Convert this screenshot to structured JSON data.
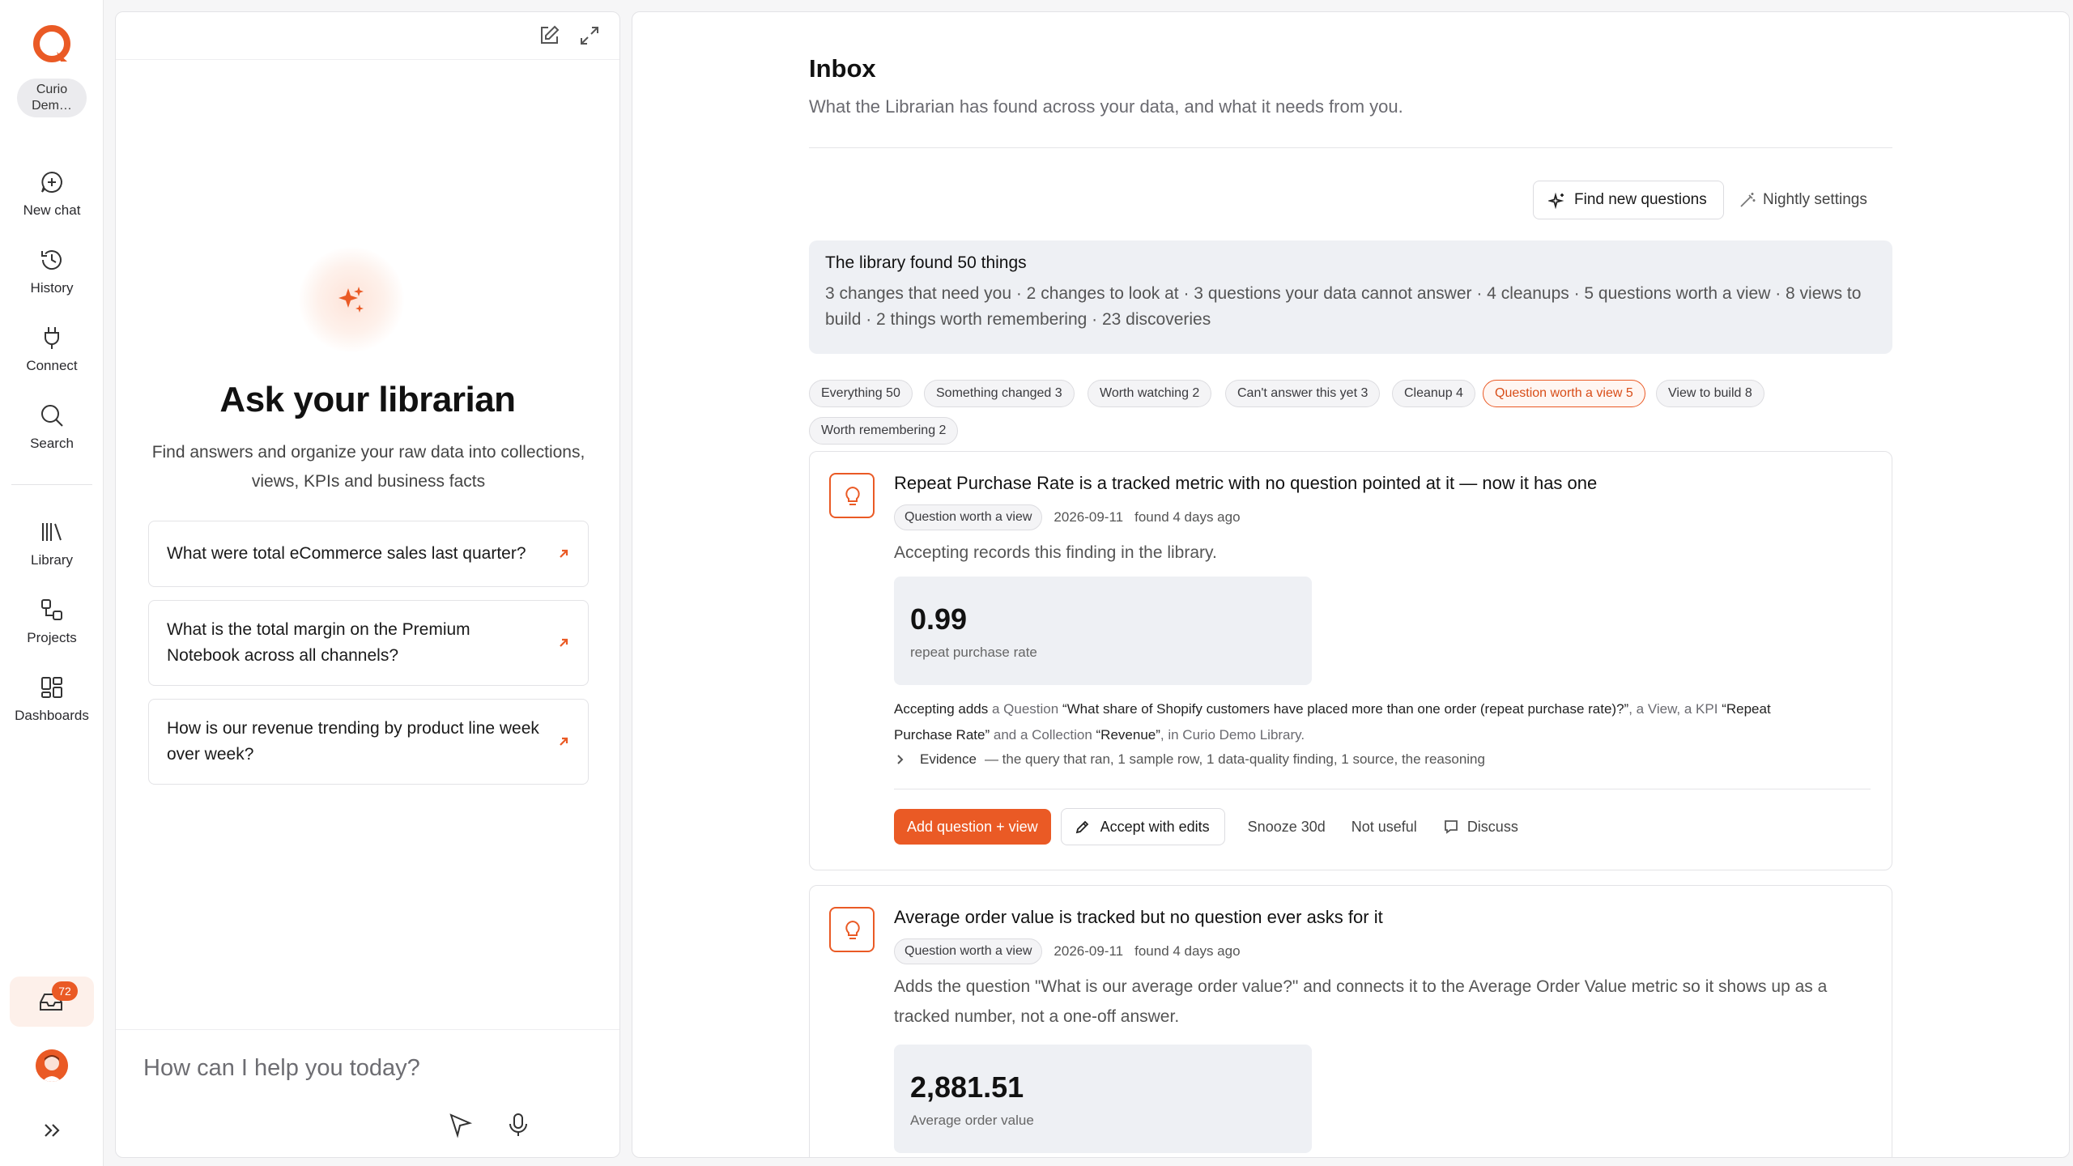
{
  "rail": {
    "workspace": "Curio Demo Library",
    "workspace_line1": "Curio",
    "workspace_line2": "Dem…",
    "items": [
      {
        "label": "New chat",
        "icon": "new-chat-icon"
      },
      {
        "label": "History",
        "icon": "history-icon"
      },
      {
        "label": "Connect",
        "icon": "plug-icon"
      },
      {
        "label": "Search",
        "icon": "search-icon"
      },
      {
        "label": "Library",
        "icon": "library-icon"
      },
      {
        "label": "Projects",
        "icon": "projects-icon"
      },
      {
        "label": "Dashboards",
        "icon": "dashboards-icon"
      }
    ],
    "inbox_badge": "72"
  },
  "chat": {
    "title": "Ask your librarian",
    "subtitle": "Find answers and organize your raw data into collections, views, KPIs and business facts",
    "suggestions": [
      "What were total eCommerce sales last quarter?",
      "What is the total margin on the Premium Notebook across all channels?",
      "How is our revenue trending by product line week over week?"
    ],
    "input_placeholder": "How can I help you today?"
  },
  "inbox": {
    "title": "Inbox",
    "subtitle": "What the Librarian has found across your data, and what it needs from you.",
    "find_button": "Find new questions",
    "nightly_button": "Nightly settings",
    "summary": {
      "title": "The library found 50 things",
      "text": "3 changes that need you · 2 changes to look at · 3 questions your data cannot answer · 4 cleanups · 5 questions worth a view · 8 views to build · 2 things worth remembering · 23 discoveries"
    },
    "filters": [
      "Everything 50",
      "Something changed 3",
      "Worth watching 2",
      "Can't answer this yet 3",
      "Cleanup 4",
      "Question worth a view 5",
      "View to build 8",
      "Worth remembering 2"
    ],
    "active_filter": "Question worth a view 5",
    "cards": [
      {
        "title": "Repeat Purchase Rate is a tracked metric with no question pointed at it — now it has one",
        "tag": "Question worth a view",
        "date": "2026-09-11",
        "found": "found 4 days ago",
        "description": "Accepting records this finding in the library.",
        "metric_value": "0.99",
        "metric_caption": "repeat purchase rate",
        "accept_prefix": "Accepting adds",
        "accept_a1": "a Question",
        "accept_q": "“What share of Shopify customers have placed more than one order (repeat purchase rate)?”",
        "accept_a2": ", a View, a KPI",
        "accept_kpi": "“Repeat Purchase Rate”",
        "accept_a3": "and a Collection",
        "accept_coll": "“Revenue”",
        "accept_a4": ", in Curio Demo Library.",
        "evidence_label": "Evidence",
        "evidence_text": "— the query that ran, 1 sample row, 1 data-quality finding, 1 source, the reasoning",
        "actions": {
          "primary": "Add question + view",
          "edit": "Accept with edits",
          "snooze": "Snooze 30d",
          "not_useful": "Not useful",
          "discuss": "Discuss"
        }
      },
      {
        "title": "Average order value is tracked but no question ever asks for it",
        "tag": "Question worth a view",
        "date": "2026-09-11",
        "found": "found 4 days ago",
        "description": "Adds the question \"What is our average order value?\" and connects it to the Average Order Value metric so it shows up as a tracked number, not a one-off answer.",
        "metric_value": "2,881.51",
        "metric_caption": "Average order value"
      }
    ]
  },
  "colors": {
    "accent": "#ea5a25",
    "summary_bg": "#eef0f4",
    "inbox_highlight": "#fdf0ea"
  }
}
